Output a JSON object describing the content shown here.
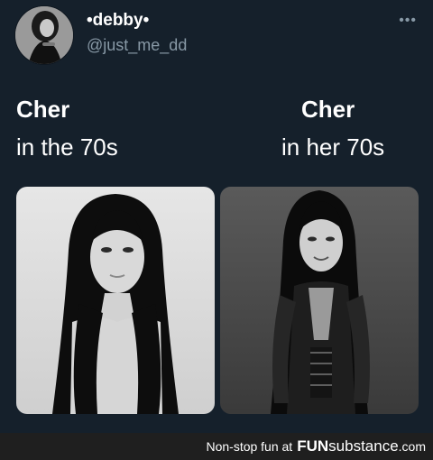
{
  "tweet": {
    "display_name": "•debby•",
    "handle": "@just_me_dd",
    "more_icon": "more-dots-icon",
    "left_column": {
      "title": "Cher",
      "subtitle": "in the 70s"
    },
    "right_column": {
      "title": "Cher",
      "subtitle": "in her 70s"
    }
  },
  "footer": {
    "tagline": "Non-stop fun at",
    "brand_fun": "FUN",
    "brand_rest": "substance",
    "brand_tld": ".com"
  },
  "colors": {
    "background": "#15202b",
    "secondary_text": "#8899a6",
    "footer_bg": "#1f1f1f"
  }
}
